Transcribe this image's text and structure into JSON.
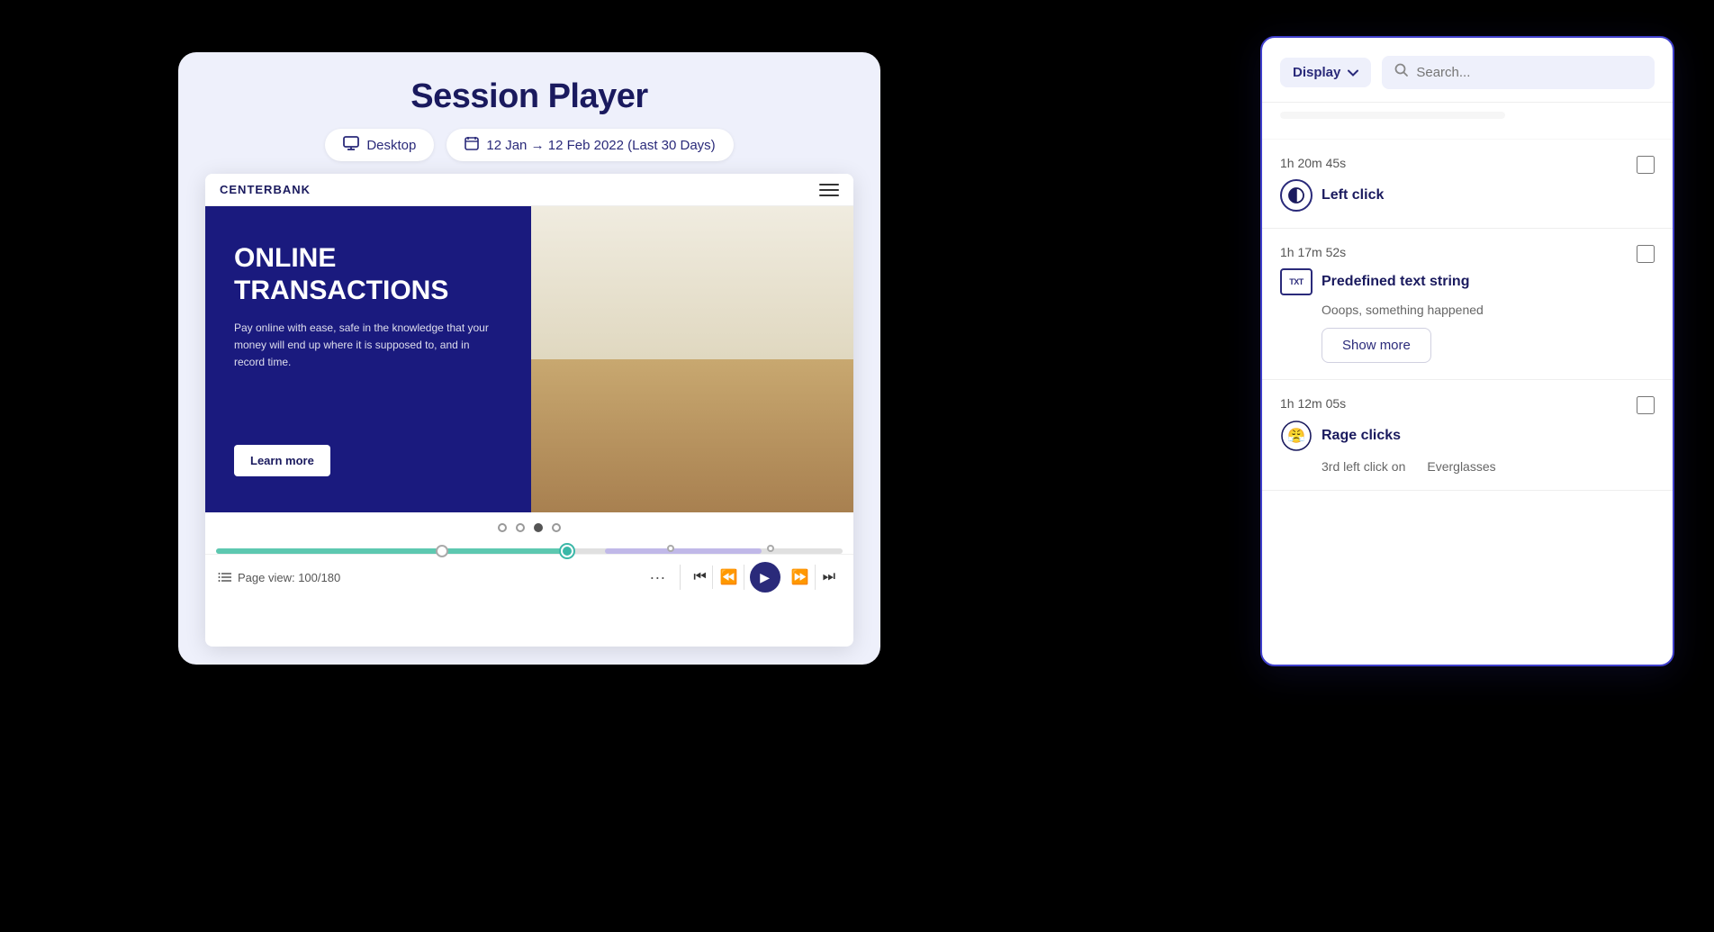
{
  "sessionPlayer": {
    "title": "Session Player",
    "desktopLabel": "Desktop",
    "dateRange": "12 Jan → 12 Feb 2022 (Last 30 Days)",
    "brand": "CENTERBANK",
    "heroTitle": "ONLINE\nTRANSACTIONS",
    "heroDesc": "Pay online with ease, safe in the knowledge that your money will end up where it is supposed to, and in record time.",
    "learnMoreLabel": "Learn more",
    "pageViewLabel": "Page view: 100/180"
  },
  "eventPanel": {
    "displayLabel": "Display",
    "searchPlaceholder": "Search...",
    "events": [
      {
        "time": "1h 20m 45s",
        "type": "left-click",
        "iconType": "half-circle",
        "label": "Left click",
        "detail": ""
      },
      {
        "time": "1h 17m 52s",
        "type": "predefined-text",
        "iconType": "txt",
        "label": "Predefined text string",
        "detail": "Ooops, something happened",
        "showMore": "Show more"
      },
      {
        "time": "1h 12m 05s",
        "type": "rage-clicks",
        "iconType": "rage",
        "label": "Rage clicks",
        "detailLeft": "3rd left click on",
        "detailRight": "Everglasses"
      }
    ]
  }
}
